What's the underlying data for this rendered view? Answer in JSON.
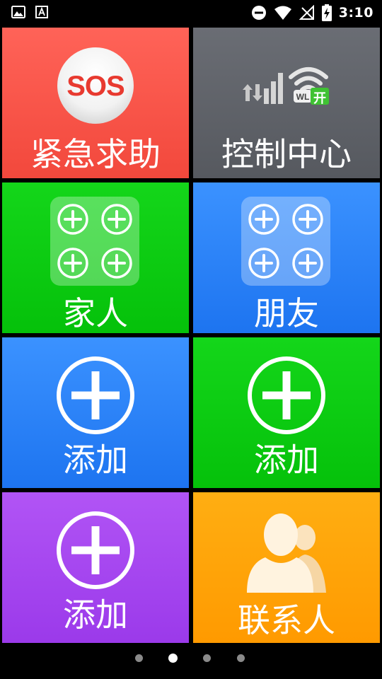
{
  "status_bar": {
    "time": "3:10",
    "icons": [
      "image-icon",
      "font-icon",
      "dnd-icon",
      "wifi-icon",
      "no-signal-icon",
      "battery-charging-icon"
    ]
  },
  "tiles": {
    "sos": {
      "label": "紧急求助",
      "badge": "SOS",
      "icon": "sos-icon",
      "color": "#f2483c"
    },
    "control": {
      "label": "控制中心",
      "wifi_badge": "WL",
      "wifi_state": "开",
      "icon": "signal-wifi-icon",
      "color": "#56595f"
    },
    "family": {
      "label": "家人",
      "icon": "four-plus-icon",
      "color": "#05c10a"
    },
    "friends": {
      "label": "朋友",
      "icon": "four-plus-icon",
      "color": "#1d74f0"
    },
    "add_1": {
      "label": "添加",
      "icon": "plus-circle-icon",
      "color": "#1d74f0"
    },
    "add_2": {
      "label": "添加",
      "icon": "plus-circle-icon",
      "color": "#05c10a"
    },
    "add_3": {
      "label": "添加",
      "icon": "plus-circle-icon",
      "color": "#9b3aea"
    },
    "contacts": {
      "label": "联系人",
      "icon": "contacts-icon",
      "color": "#ff9a00"
    }
  },
  "pager": {
    "count": 4,
    "active_index": 1
  }
}
